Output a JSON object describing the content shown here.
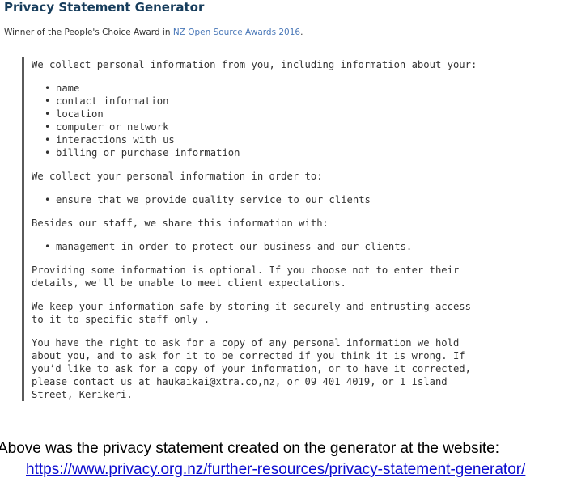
{
  "header": {
    "title": "Privacy Statement Generator",
    "award_prefix": "Winner of the People's Choice Award in ",
    "award_link": "NZ Open Source Awards 2016",
    "award_suffix": "."
  },
  "statement": {
    "intro": "We collect personal information from you, including information about your:",
    "collected_items": [
      "name",
      "contact information",
      "location",
      "computer or network",
      "interactions with us",
      "billing or purchase information"
    ],
    "purpose_intro": "We collect your personal information in order to:",
    "purposes": [
      "ensure that we provide quality service to our clients"
    ],
    "sharing_intro": "Besides our staff, we share this information with:",
    "sharing": [
      "management in order to protect our business and our clients."
    ],
    "optional_line1": "Providing some information is optional. If you choose not to enter their",
    "optional_line2": "details, we'll be unable to meet client expectations.",
    "safe_line1": "We keep your information safe by storing it securely and entrusting access",
    "safe_line2": "to it to specific staff only .",
    "rights_line1": "You have the right to ask for a copy of any personal information we hold",
    "rights_line2": "about you, and to ask for it to be corrected if you think it is wrong. If",
    "rights_line3": "you’d like to ask for a copy of your information, or to have it corrected,",
    "rights_line4": "please contact us at haukaikai@xtra.co,nz, or 09 401 4019, or 1 Island",
    "rights_line5": "Street, Kerikeri."
  },
  "caption": {
    "text": "Above was the privacy statement created on the generator at the website:",
    "url": "https://www.privacy.org.nz/further-resources/privacy-statement-generator/"
  }
}
